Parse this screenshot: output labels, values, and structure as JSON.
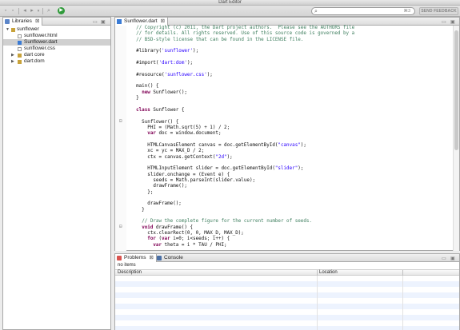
{
  "window": {
    "title": "Dart Editor"
  },
  "toolbar": {
    "search_hint": "⌘3",
    "feedback_label": "SEND FEEDBACK"
  },
  "libraries": {
    "tab_label": "Libraries",
    "tree": [
      {
        "label": "sunflower",
        "level": 0,
        "expanded": true,
        "icon": "library"
      },
      {
        "label": "sunflower.html",
        "level": 1,
        "icon": "html-file"
      },
      {
        "label": "Sunflower.dart",
        "level": 1,
        "icon": "dart-file",
        "selected": true
      },
      {
        "label": "sunflower.css",
        "level": 1,
        "icon": "css-file"
      },
      {
        "label": "dart core",
        "level": 1,
        "expanded": false,
        "icon": "library"
      },
      {
        "label": "dart:dom",
        "level": 1,
        "expanded": false,
        "icon": "library"
      }
    ]
  },
  "editor": {
    "tab_label": "Sunflower.dart",
    "lines": [
      "  // Copyright (c) 2011, the Dart project authors.  Please see the AUTHORS file",
      "  // for details. All rights reserved. Use of this source code is governed by a",
      "  // BSD-style license that can be found in the LICENSE file.",
      "",
      "  #library('sunflower');",
      "",
      "  #import('dart:dom');",
      "",
      "  #resource('sunflower.css');",
      "",
      "  main() {",
      "    new Sunflower();",
      "  }",
      "",
      "  class Sunflower {",
      "",
      "    Sunflower() {",
      "      PHI = (Math.sqrt(5) + 1) / 2;",
      "      var doc = window.document;",
      "",
      "      HTMLCanvasElement canvas = doc.getElementById(\"canvas\");",
      "      xc = yc = MAX_D / 2;",
      "      ctx = canvas.getContext(\"2d\");",
      "",
      "      HTMLInputElement slider = doc.getElementById(\"slider\");",
      "      slider.onchange = (Event e) {",
      "        seeds = Math.parseInt(slider.value);",
      "        drawFrame();",
      "      };",
      "",
      "      drawFrame();",
      "    }",
      "",
      "    // Draw the complete figure for the current number of seeds.",
      "    void drawFrame() {",
      "      ctx.clearRect(0, 0, MAX_D, MAX_D);",
      "      for (var i=0; i<seeds; i++) {",
      "        var theta = i * TAU / PHI;"
    ]
  },
  "bottom": {
    "tabs": [
      {
        "label": "Problems",
        "active": true
      },
      {
        "label": "Console",
        "active": false
      }
    ],
    "items_count": "no items",
    "columns": [
      "Description",
      "Location"
    ]
  }
}
